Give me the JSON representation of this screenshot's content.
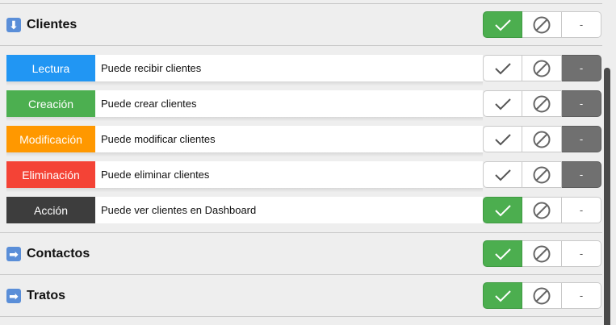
{
  "sections": {
    "clientes": {
      "title": "Clientes",
      "arrow": "⬇",
      "icon": "arrow-down-icon"
    },
    "contactos": {
      "title": "Contactos",
      "arrow": "➡",
      "icon": "arrow-right-icon"
    },
    "tratos": {
      "title": "Tratos",
      "arrow": "➡",
      "icon": "arrow-right-icon"
    }
  },
  "permissions": [
    {
      "badge": "Lectura",
      "color": "#2196f3",
      "description": "Puede recibir clientes",
      "state": "dash"
    },
    {
      "badge": "Creación",
      "color": "#4caf50",
      "description": "Puede crear clientes",
      "state": "dash"
    },
    {
      "badge": "Modificación",
      "color": "#ff9800",
      "description": "Puede modificar clientes",
      "state": "dash"
    },
    {
      "badge": "Eliminación",
      "color": "#f44336",
      "description": "Puede eliminar clientes",
      "state": "dash"
    },
    {
      "badge": "Acción",
      "color": "#3d3d3d",
      "description": "Puede ver clientes en Dashboard",
      "state": "check"
    }
  ],
  "controls": {
    "allow_icon": "check-icon",
    "deny_icon": "ban-icon",
    "inherit_label": "-"
  },
  "colors": {
    "green": "#4cae4f",
    "dark_gray": "#707070"
  }
}
